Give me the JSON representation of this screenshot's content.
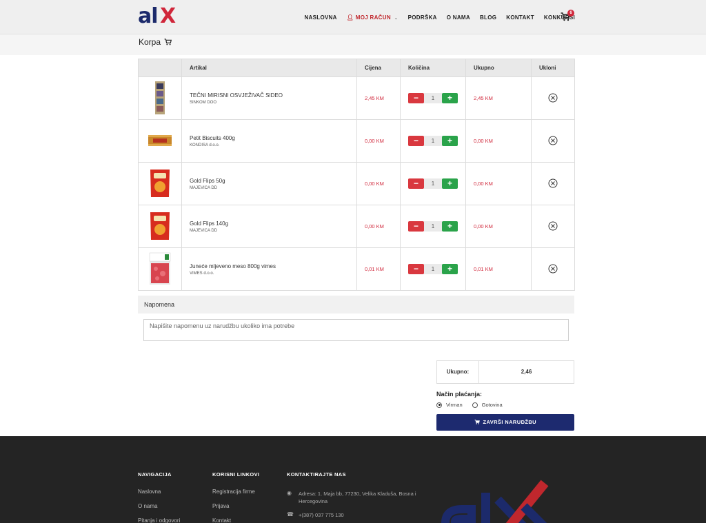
{
  "header": {
    "logo_text_a": "al",
    "logo_text_x": "X",
    "nav": [
      "NASLOVNA",
      "MOJ RAČUN",
      "PODRŠKA",
      "O NAMA",
      "BLOG",
      "KONTAKT",
      "KONKURSI"
    ],
    "cart_count": "6",
    "colors": {
      "brand_blue": "#1c2a6b",
      "brand_red": "#d0263a"
    }
  },
  "page": {
    "title": "Korpa"
  },
  "table": {
    "headers": [
      "",
      "Artikal",
      "Cijena",
      "Količina",
      "Ukupno",
      "Ukloni"
    ],
    "rows": [
      {
        "name": "TEČNI MIRISNI OSVJEŽIVAČ SIDEO",
        "vendor": "SINKOM DOO",
        "price": "2,45 KM",
        "qty": "1",
        "total": "2,45 KM"
      },
      {
        "name": "Petit Biscuits 400g",
        "vendor": "KONDISA d.o.o.",
        "price": "0,00 KM",
        "qty": "1",
        "total": "0,00 KM"
      },
      {
        "name": "Gold Flips 50g",
        "vendor": "MAJEVICA DD",
        "price": "0,00 KM",
        "qty": "1",
        "total": "0,00 KM"
      },
      {
        "name": "Gold Flips 140g",
        "vendor": "MAJEVICA DD",
        "price": "0,00 KM",
        "qty": "1",
        "total": "0,00 KM"
      },
      {
        "name": "Juneće mljeveno meso 800g vimes",
        "vendor": "VIMES d.o.o.",
        "price": "0,01 KM",
        "qty": "1",
        "total": "0,01 KM"
      }
    ],
    "minus": "−",
    "plus": "+"
  },
  "note": {
    "title": "Napomena",
    "placeholder": "Napišite napomenu uz narudžbu ukoliko ima potrebe"
  },
  "summary": {
    "total_label": "Ukupno:",
    "total_value": "2,46",
    "payment_title": "Način plaćanja:",
    "payment_options": [
      "Virman",
      "Gotovina"
    ],
    "payment_selected": "Virman",
    "finish_label": "ZAVRŠI NARUDŽBU"
  },
  "footer": {
    "col1_title": "NAVIGACIJA",
    "col1_links": [
      "Naslovna",
      "O nama",
      "Pitanja i odgovori"
    ],
    "col2_title": "KORISNI LINKOVI",
    "col2_links": [
      "Registracija firme",
      "Prijava",
      "Kontakt"
    ],
    "col3_title": "KONTAKTIRAJTE NAS",
    "address": "Adresa: 1. Maja bb, 77230, Velika Kladuša, Bosna i Hercegovina",
    "phone": "+(387) 037 775 130"
  }
}
